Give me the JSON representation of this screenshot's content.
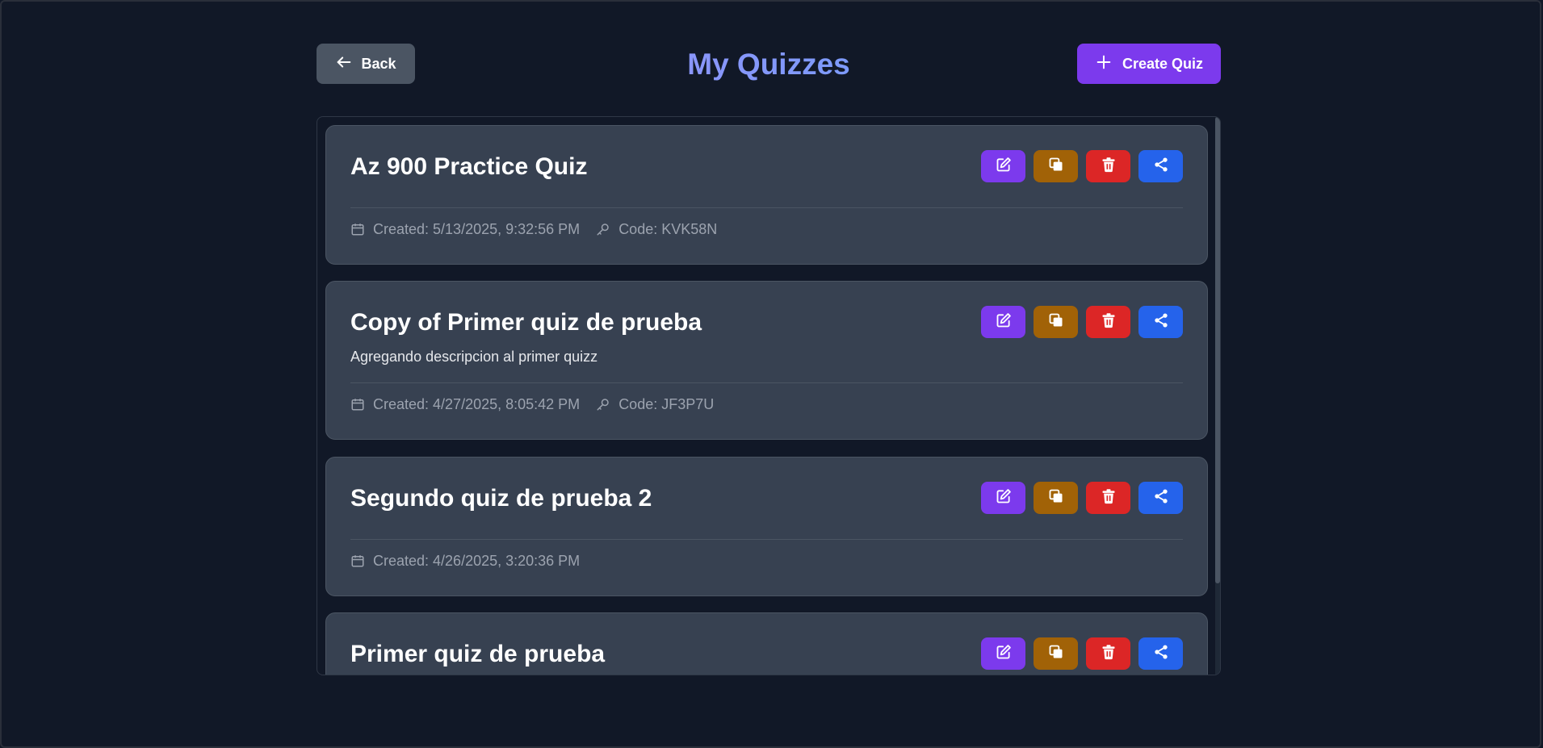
{
  "header": {
    "back_label": "Back",
    "title": "My Quizzes",
    "create_label": "Create Quiz"
  },
  "quizzes": [
    {
      "title": "Az 900 Practice Quiz",
      "description": "",
      "created": "Created: 5/13/2025, 9:32:56 PM",
      "code": "Code: KVK58N"
    },
    {
      "title": "Copy of Primer quiz de prueba",
      "description": "Agregando descripcion al primer quizz",
      "created": "Created: 4/27/2025, 8:05:42 PM",
      "code": "Code: JF3P7U"
    },
    {
      "title": "Segundo quiz de prueba 2",
      "description": "",
      "created": "Created: 4/26/2025, 3:20:36 PM",
      "code": ""
    },
    {
      "title": "Primer quiz de prueba",
      "description": "",
      "created": "",
      "code": ""
    }
  ],
  "icons": {
    "back": "arrow-left-icon",
    "create": "plus-icon",
    "edit": "edit-icon",
    "duplicate": "copy-icon",
    "delete": "trash-icon",
    "share": "share-icon",
    "created": "calendar-icon",
    "code": "key-icon"
  },
  "colors": {
    "background": "#111827",
    "card": "#374151",
    "accent": "#7c3aed",
    "edit": "#7c3aed",
    "duplicate": "#a16207",
    "delete": "#dc2626",
    "share": "#2563eb"
  }
}
